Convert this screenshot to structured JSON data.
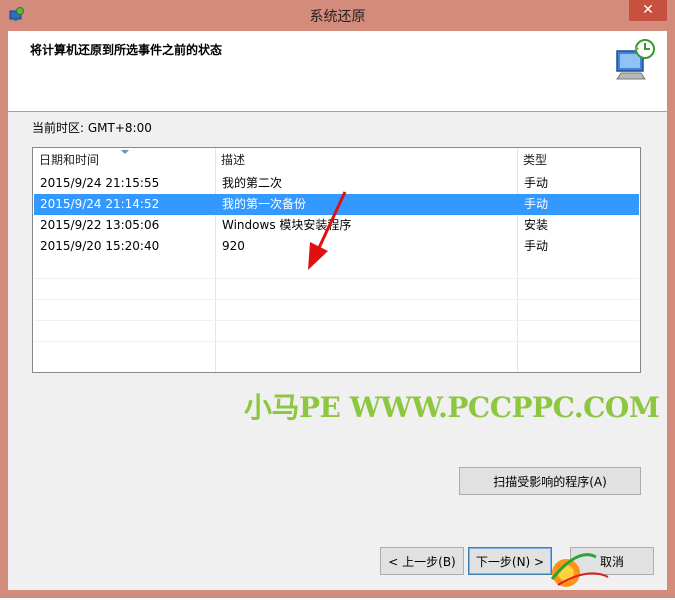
{
  "window": {
    "title": "系统还原",
    "close_glyph": "✕"
  },
  "header": {
    "title": "将计算机还原到所选事件之前的状态"
  },
  "timezone_label": "当前时区: GMT+8:00",
  "table": {
    "columns": [
      "日期和时间",
      "描述",
      "类型"
    ],
    "rows": [
      {
        "datetime": "2015/9/24 21:15:55",
        "description": "我的第二次",
        "type": "手动",
        "selected": false
      },
      {
        "datetime": "2015/9/24 21:14:52",
        "description": "我的第一次备份",
        "type": "手动",
        "selected": true
      },
      {
        "datetime": "2015/9/22 13:05:06",
        "description": "Windows 模块安装程序",
        "type": "安装",
        "selected": false
      },
      {
        "datetime": "2015/9/20 15:20:40",
        "description": "920",
        "type": "手动",
        "selected": false
      }
    ]
  },
  "watermark": "小马PE WWW.PCCPPC.COM",
  "buttons": {
    "scan": "扫描受影响的程序(A)",
    "back": "< 上一步(B)",
    "next": "下一步(N) >",
    "cancel": "取消"
  },
  "colors": {
    "frame": "#d38b7b",
    "selection": "#3399ff",
    "watermark": "#8dc63f",
    "close_button": "#c7503f"
  }
}
